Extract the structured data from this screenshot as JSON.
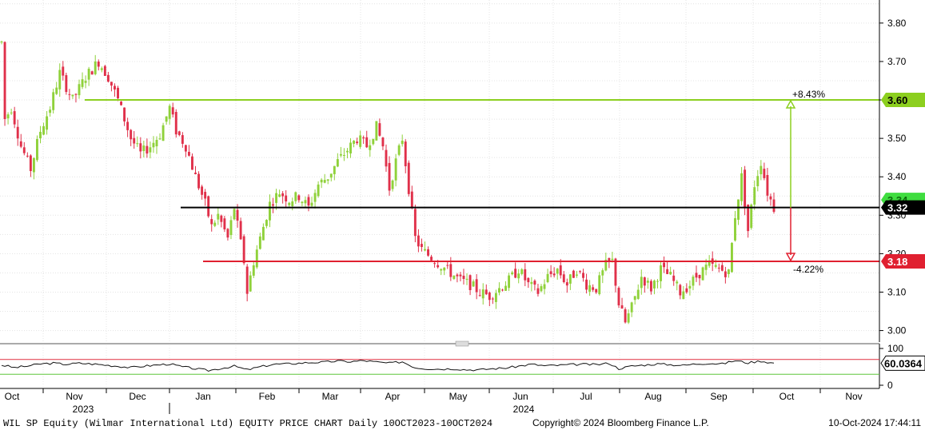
{
  "colors": {
    "up": "#8fd13a",
    "down": "#e0304a",
    "resistance": "#8ccf1f",
    "support": "#e02030",
    "pivot": "#000000",
    "current_badge": "#3fdd3f",
    "rsi_line": "#111111",
    "rsi_upper": "#e03040",
    "rsi_lower": "#5fc63a"
  },
  "chart_data": {
    "type": "candlestick",
    "ticker": "WIL SP Equity",
    "ylim": [
      2.97,
      3.86
    ],
    "y_ticks": [
      "3.80",
      "3.70",
      "3.60",
      "3.50",
      "3.40",
      "3.30",
      "3.20",
      "3.10",
      "3.00"
    ],
    "x_month_labels": [
      "Oct",
      "Nov",
      "Dec",
      "Jan",
      "Feb",
      "Mar",
      "Apr",
      "May",
      "Jun",
      "Jul",
      "Aug",
      "Sep",
      "Oct",
      "Nov"
    ],
    "year_labels": [
      "2023",
      "2024"
    ],
    "grid": true,
    "price_path": [
      [
        0,
        3.75
      ],
      [
        1,
        3.55
      ],
      [
        3,
        3.58
      ],
      [
        6,
        3.48
      ],
      [
        9,
        3.42
      ],
      [
        12,
        3.52
      ],
      [
        15,
        3.58
      ],
      [
        18,
        3.67
      ],
      [
        22,
        3.6
      ],
      [
        26,
        3.66
      ],
      [
        30,
        3.7
      ],
      [
        33,
        3.66
      ],
      [
        36,
        3.6
      ],
      [
        40,
        3.5
      ],
      [
        43,
        3.46
      ],
      [
        46,
        3.48
      ],
      [
        49,
        3.51
      ],
      [
        52,
        3.58
      ],
      [
        54,
        3.52
      ],
      [
        57,
        3.48
      ],
      [
        60,
        3.4
      ],
      [
        63,
        3.33
      ],
      [
        65,
        3.27
      ],
      [
        67,
        3.3
      ],
      [
        70,
        3.24
      ],
      [
        72,
        3.32
      ],
      [
        75,
        3.18
      ],
      [
        76,
        3.1
      ],
      [
        78,
        3.18
      ],
      [
        80,
        3.24
      ],
      [
        83,
        3.33
      ],
      [
        86,
        3.36
      ],
      [
        89,
        3.34
      ],
      [
        92,
        3.35
      ],
      [
        95,
        3.32
      ],
      [
        98,
        3.38
      ],
      [
        101,
        3.4
      ],
      [
        104,
        3.44
      ],
      [
        107,
        3.47
      ],
      [
        110,
        3.5
      ],
      [
        113,
        3.48
      ],
      [
        116,
        3.53
      ],
      [
        118,
        3.48
      ],
      [
        120,
        3.37
      ],
      [
        122,
        3.44
      ],
      [
        124,
        3.5
      ],
      [
        126,
        3.37
      ],
      [
        128,
        3.24
      ],
      [
        130,
        3.21
      ],
      [
        133,
        3.19
      ],
      [
        136,
        3.17
      ],
      [
        139,
        3.15
      ],
      [
        142,
        3.13
      ],
      [
        145,
        3.12
      ],
      [
        148,
        3.1
      ],
      [
        151,
        3.09
      ],
      [
        154,
        3.11
      ],
      [
        157,
        3.13
      ],
      [
        160,
        3.16
      ],
      [
        163,
        3.12
      ],
      [
        166,
        3.1
      ],
      [
        169,
        3.14
      ],
      [
        172,
        3.16
      ],
      [
        175,
        3.12
      ],
      [
        178,
        3.16
      ],
      [
        181,
        3.12
      ],
      [
        184,
        3.11
      ],
      [
        187,
        3.17
      ],
      [
        189,
        3.18
      ],
      [
        191,
        3.07
      ],
      [
        193,
        3.02
      ],
      [
        195,
        3.06
      ],
      [
        198,
        3.14
      ],
      [
        201,
        3.11
      ],
      [
        204,
        3.16
      ],
      [
        207,
        3.14
      ],
      [
        210,
        3.1
      ],
      [
        213,
        3.12
      ],
      [
        216,
        3.15
      ],
      [
        219,
        3.17
      ],
      [
        222,
        3.16
      ],
      [
        225,
        3.15
      ],
      [
        227,
        3.3
      ],
      [
        229,
        3.4
      ],
      [
        231,
        3.26
      ],
      [
        233,
        3.38
      ],
      [
        235,
        3.44
      ],
      [
        237,
        3.36
      ],
      [
        239,
        3.32
      ]
    ],
    "last_bar_index": 239,
    "x_pixel_per_bar_ref": "computed",
    "levels": {
      "resistance": {
        "value": 3.6,
        "label": "3.60",
        "pct": "+8.43%"
      },
      "pivot": {
        "value": 3.32,
        "label": "3.32"
      },
      "support": {
        "value": 3.18,
        "label": "3.18",
        "pct": "-4.22%"
      },
      "current": {
        "value": 3.34,
        "label": "3.34"
      }
    },
    "rsi": {
      "ticks": [
        "100",
        "0"
      ],
      "upper": 70,
      "lower": 30,
      "last_value": "60.0364",
      "path": [
        [
          0,
          55
        ],
        [
          4,
          48
        ],
        [
          8,
          52
        ],
        [
          12,
          58
        ],
        [
          16,
          60
        ],
        [
          20,
          57
        ],
        [
          24,
          60
        ],
        [
          28,
          58
        ],
        [
          32,
          55
        ],
        [
          36,
          52
        ],
        [
          40,
          48
        ],
        [
          44,
          52
        ],
        [
          48,
          55
        ],
        [
          52,
          58
        ],
        [
          56,
          50
        ],
        [
          60,
          45
        ],
        [
          64,
          40
        ],
        [
          68,
          46
        ],
        [
          72,
          52
        ],
        [
          76,
          42
        ],
        [
          80,
          50
        ],
        [
          84,
          57
        ],
        [
          88,
          58
        ],
        [
          92,
          60
        ],
        [
          96,
          62
        ],
        [
          100,
          63
        ],
        [
          104,
          66
        ],
        [
          108,
          64
        ],
        [
          112,
          67
        ],
        [
          116,
          63
        ],
        [
          120,
          60
        ],
        [
          124,
          64
        ],
        [
          128,
          48
        ],
        [
          132,
          45
        ],
        [
          136,
          44
        ],
        [
          140,
          45
        ],
        [
          144,
          42
        ],
        [
          148,
          42
        ],
        [
          152,
          45
        ],
        [
          156,
          47
        ],
        [
          160,
          52
        ],
        [
          164,
          57
        ],
        [
          168,
          53
        ],
        [
          172,
          54
        ],
        [
          176,
          56
        ],
        [
          180,
          57
        ],
        [
          184,
          56
        ],
        [
          188,
          60
        ],
        [
          191,
          45
        ],
        [
          195,
          52
        ],
        [
          199,
          55
        ],
        [
          203,
          58
        ],
        [
          207,
          56
        ],
        [
          211,
          54
        ],
        [
          215,
          58
        ],
        [
          219,
          60
        ],
        [
          223,
          58
        ],
        [
          227,
          67
        ],
        [
          231,
          61
        ],
        [
          235,
          66
        ],
        [
          239,
          60
        ]
      ]
    }
  },
  "footer": {
    "left": "WIL SP Equity (Wilmar International Ltd) EQUITY PRICE CHART  Daily 10OCT2023-10OCT2024",
    "center": "Copyright© 2024 Bloomberg Finance L.P.",
    "right": "10-Oct-2024 17:44:11"
  }
}
